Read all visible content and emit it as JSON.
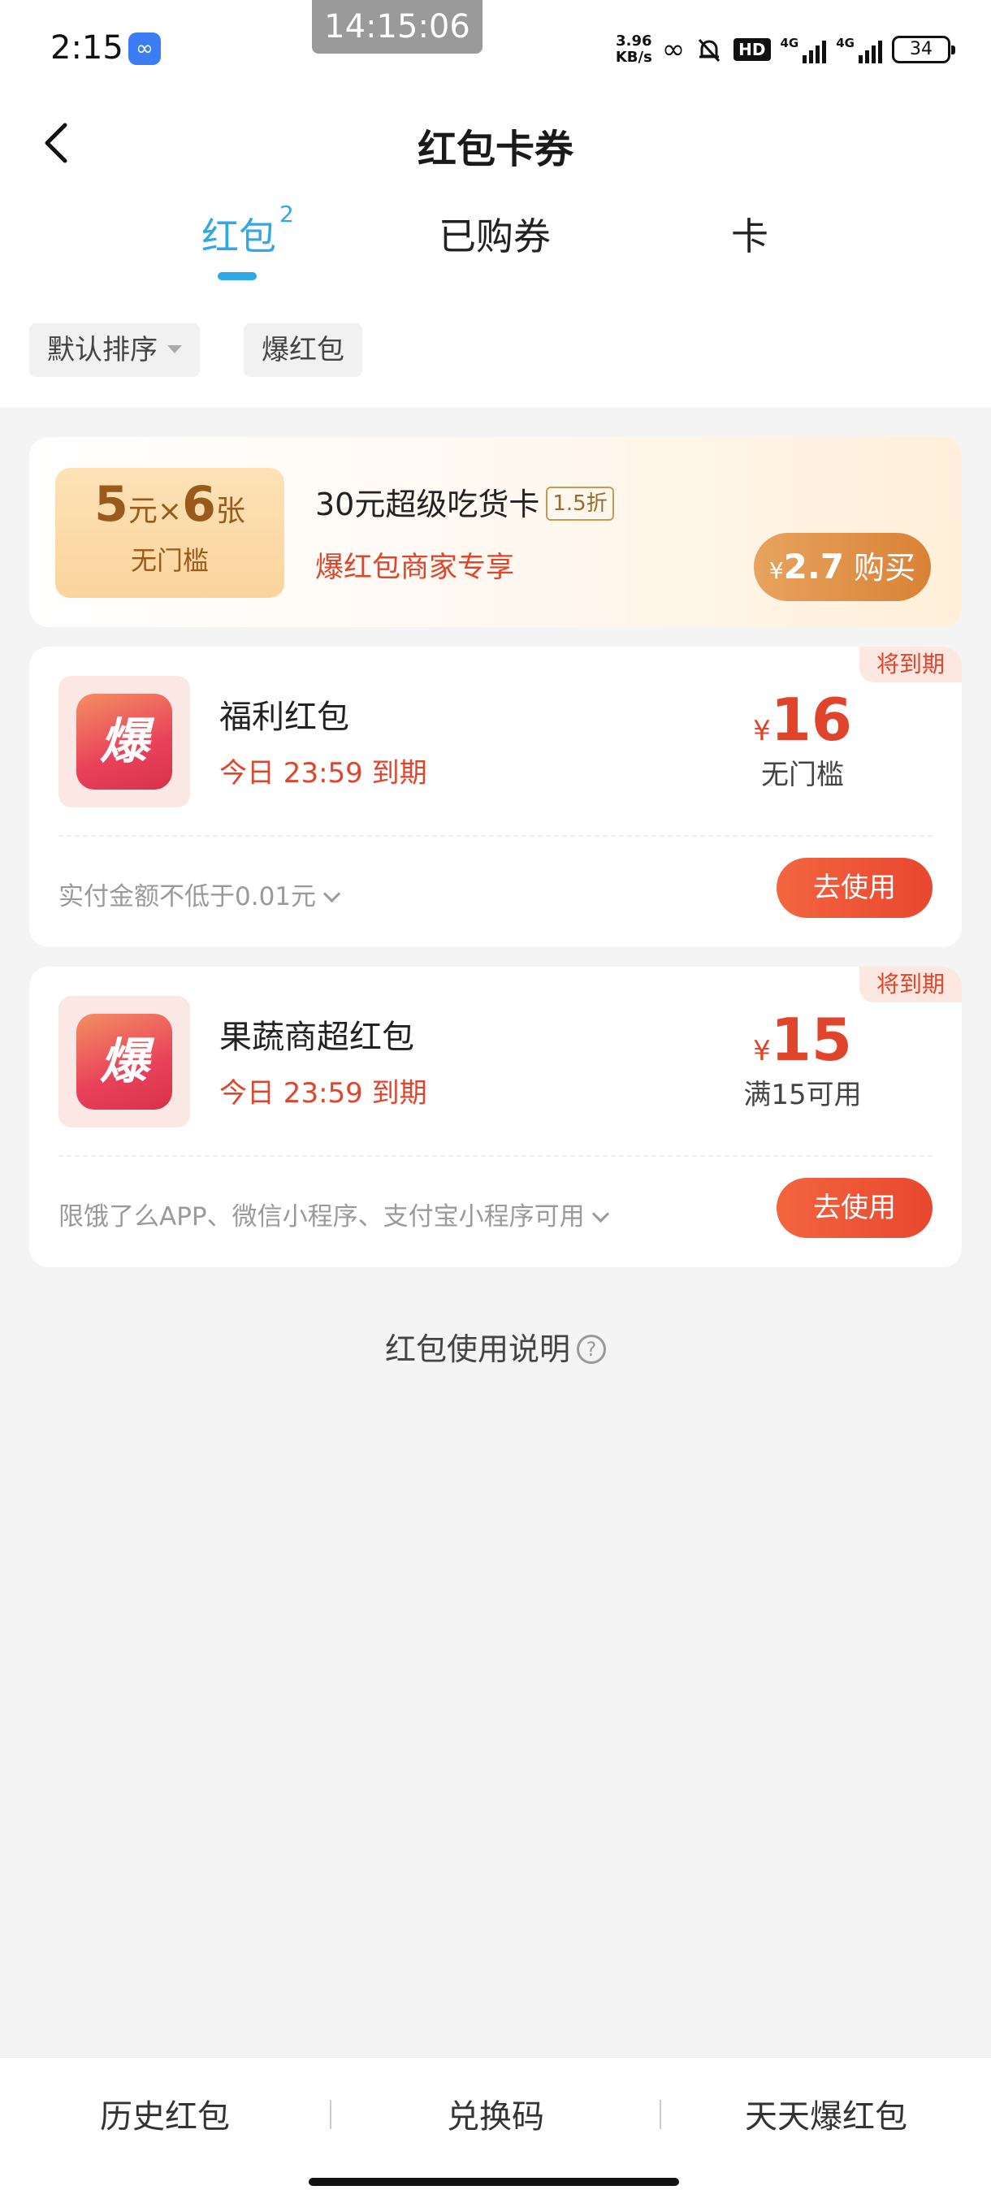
{
  "status_bar": {
    "time": "2:15",
    "clock_overlay": "14:15:06",
    "net_speed": "3.96",
    "net_speed_unit": "KB/s",
    "signal_label": "4G",
    "battery": "34"
  },
  "header": {
    "title": "红包卡券"
  },
  "tabs": [
    {
      "label": "红包",
      "badge": "2"
    },
    {
      "label": "已购券"
    },
    {
      "label": "卡"
    }
  ],
  "filters": {
    "sort": "默认排序",
    "type": "爆红包"
  },
  "promo": {
    "ticket_amount": "5",
    "ticket_unit": "元",
    "ticket_times": "×",
    "ticket_count": "6",
    "ticket_count_unit": "张",
    "ticket_threshold": "无门槛",
    "name": "30元超级吃货卡",
    "discount": "1.5折",
    "desc": "爆红包商家专享",
    "price_symbol": "¥",
    "price": "2.7",
    "buy_label": "购买"
  },
  "coupons": [
    {
      "tag": "将到期",
      "logo_char": "爆",
      "title": "福利红包",
      "expiry": "今日 23:59 到期",
      "currency": "¥",
      "amount": "16",
      "threshold": "无门槛",
      "note": "实付金额不低于0.01元",
      "use_label": "去使用"
    },
    {
      "tag": "将到期",
      "logo_char": "爆",
      "title": "果蔬商超红包",
      "expiry": "今日 23:59 到期",
      "currency": "¥",
      "amount": "15",
      "threshold": "满15可用",
      "note": "限饿了么APP、微信小程序、支付宝小程序可用",
      "use_label": "去使用"
    }
  ],
  "help": {
    "label": "红包使用说明",
    "icon_char": "?"
  },
  "bottom_bar": {
    "history": "历史红包",
    "redeem": "兑换码",
    "daily": "天天爆红包"
  },
  "colors": {
    "accent_blue": "#2fa8e6",
    "accent_red": "#e0452c",
    "gold": "#9a5a1b"
  }
}
